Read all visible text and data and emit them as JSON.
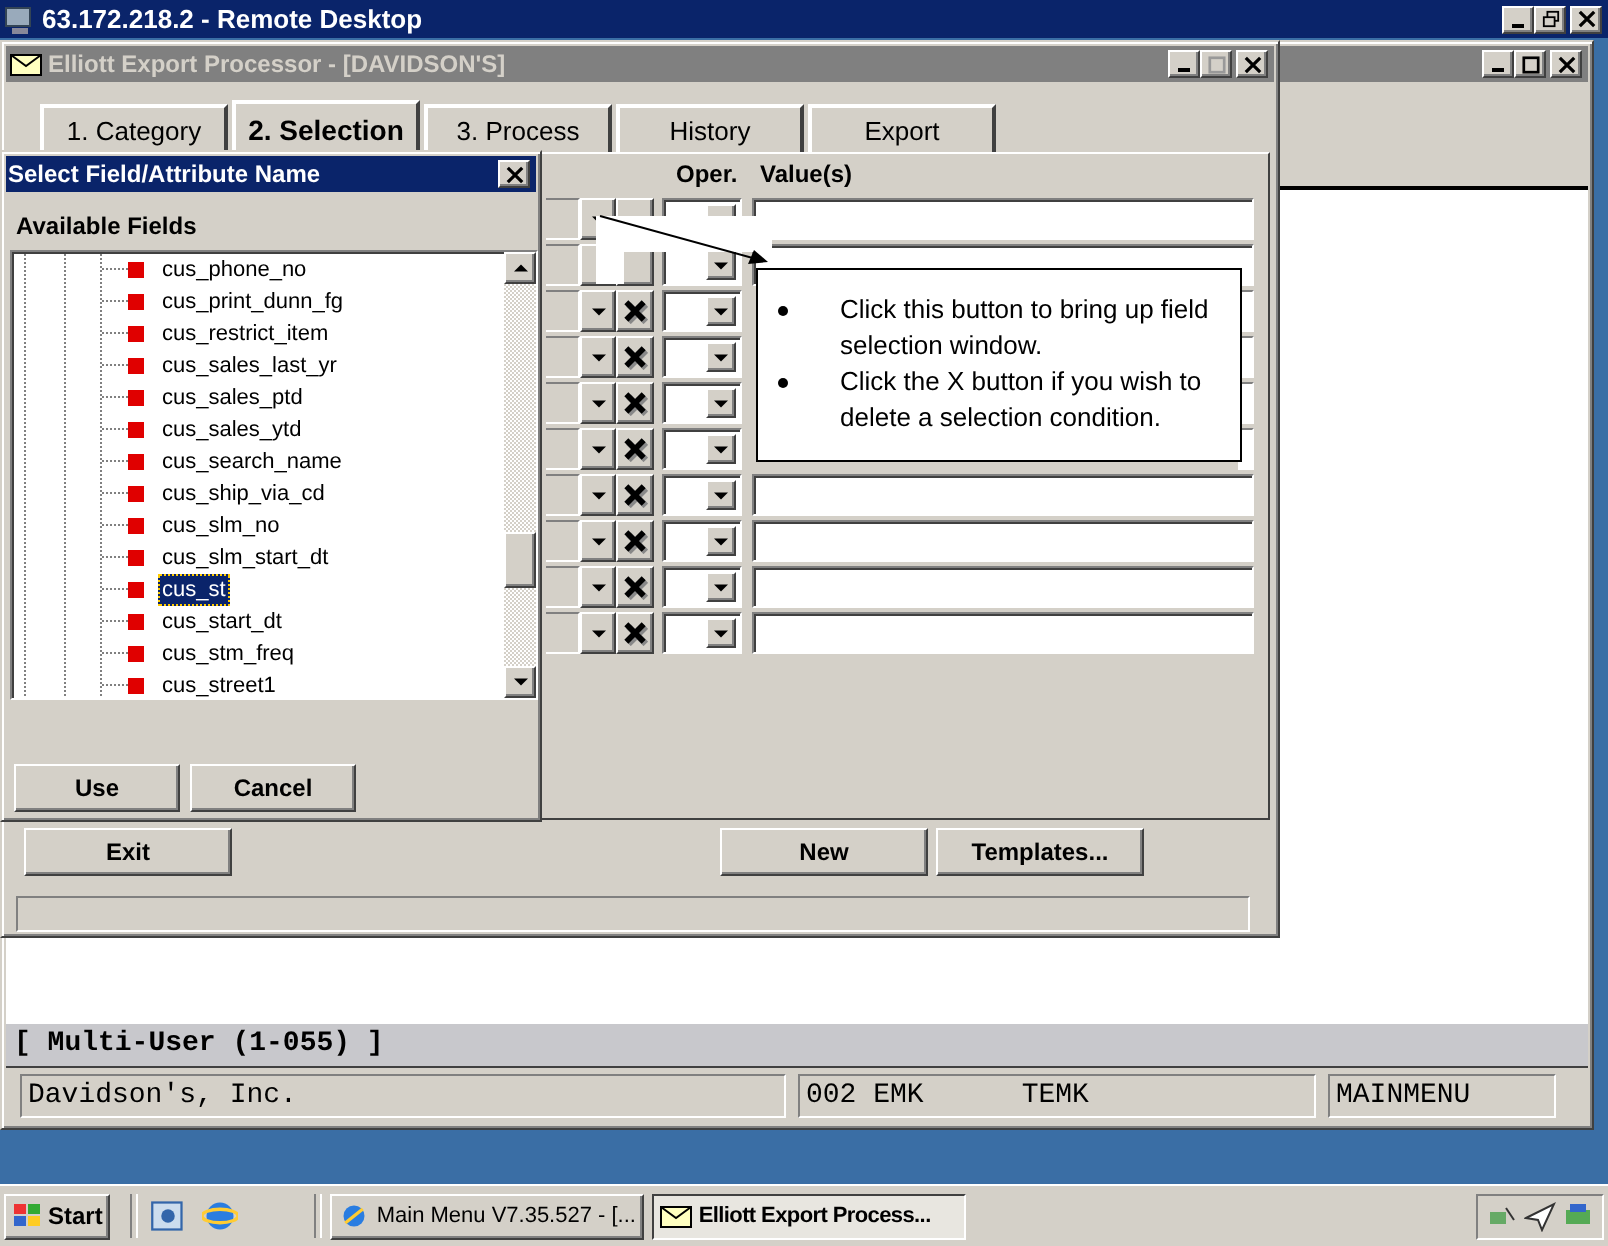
{
  "remote_desktop": {
    "title": "63.172.218.2 - Remote Desktop"
  },
  "main_window": {
    "banner": "[ Multi-User (1-055) ]",
    "status_bar": {
      "company": "Davidson's, Inc.",
      "user": "002 EMK",
      "terminal": "TEMK",
      "menu": "MAINMENU"
    }
  },
  "export_window": {
    "title": "Elliott Export Processor - [DAVIDSON'S]",
    "tabs": [
      {
        "label": "1. Category",
        "selected": false
      },
      {
        "label": "2. Selection",
        "selected": true
      },
      {
        "label": "3. Process",
        "selected": false
      },
      {
        "label": "History",
        "selected": false
      },
      {
        "label": "Export",
        "selected": false
      }
    ],
    "columns": [
      "Oper.",
      "Value(s)"
    ],
    "buttons": [
      "Exit",
      "New",
      "Templates..."
    ]
  },
  "dialog": {
    "title": "Select Field/Attribute Name",
    "list_label": "Available Fields",
    "fields": [
      {
        "label": "cus_phone_no",
        "selected": false
      },
      {
        "label": "cus_print_dunn_fg",
        "selected": false
      },
      {
        "label": "cus_restrict_item",
        "selected": false
      },
      {
        "label": "cus_sales_last_yr",
        "selected": false
      },
      {
        "label": "cus_sales_ptd",
        "selected": false
      },
      {
        "label": "cus_sales_ytd",
        "selected": false
      },
      {
        "label": "cus_search_name",
        "selected": false
      },
      {
        "label": "cus_ship_via_cd",
        "selected": false
      },
      {
        "label": "cus_slm_no",
        "selected": false
      },
      {
        "label": "cus_slm_start_dt",
        "selected": false
      },
      {
        "label": "cus_st",
        "selected": true
      },
      {
        "label": "cus_start_dt",
        "selected": false
      },
      {
        "label": "cus_stm_freq",
        "selected": false
      },
      {
        "label": "cus_street1",
        "selected": false
      }
    ],
    "buttons": [
      "Use",
      "Cancel"
    ]
  },
  "callout": {
    "bullets": [
      "Click this button to bring up field selection window.",
      "Click the X button if you wish to delete a selection condition."
    ]
  },
  "taskbar": {
    "start": "Start",
    "tasks": [
      {
        "label": "Main Menu V7.35.527 - [...",
        "selected": false
      },
      {
        "label": "Elliott Export Process...",
        "selected": true
      }
    ]
  }
}
